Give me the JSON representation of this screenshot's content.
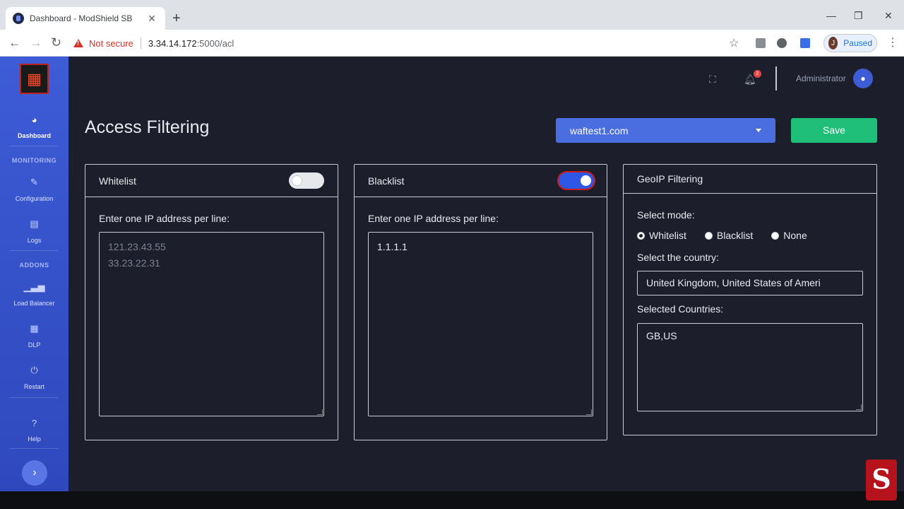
{
  "browser": {
    "tab_title": "Dashboard - ModShield SB",
    "tab_close": "✕",
    "new_tab": "+",
    "not_secure": "Not secure",
    "url_host": "3.34.14.172",
    "url_path": ":5000/acl",
    "profile_initial": "J",
    "profile_status": "Paused",
    "window_controls": {
      "minimize": "—",
      "maximize": "❐",
      "close": "✕"
    }
  },
  "sidebar": {
    "items": [
      {
        "label": "Dashboard",
        "icon": "dashboard-icon",
        "active": true
      },
      {
        "label": "Configuration",
        "icon": "wrench-icon"
      },
      {
        "label": "Logs",
        "icon": "logs-icon"
      },
      {
        "label": "Load Balancer",
        "icon": "chart-icon"
      },
      {
        "label": "DLP",
        "icon": "grid-icon"
      },
      {
        "label": "Restart",
        "icon": "power-icon"
      },
      {
        "label": "Help",
        "icon": "help-icon"
      }
    ],
    "sections": {
      "monitoring": "MONITORING",
      "addons": "ADDONS"
    }
  },
  "topbar": {
    "notification_count": "2",
    "user_name": "Administrator"
  },
  "page": {
    "title": "Access Filtering",
    "site_selected": "waftest1.com",
    "save_label": "Save"
  },
  "whitelist": {
    "title": "Whitelist",
    "enabled": false,
    "instruction": "Enter one IP address per line:",
    "placeholder_lines": [
      "121.23.43.55",
      "33.23.22.31"
    ]
  },
  "blacklist": {
    "title": "Blacklist",
    "enabled": true,
    "instruction": "Enter one IP address per line:",
    "value_lines": [
      "1.1.1.1"
    ]
  },
  "geoip": {
    "title": "GeoIP Filtering",
    "mode_label": "Select mode:",
    "modes": [
      {
        "label": "Whitelist",
        "checked": true
      },
      {
        "label": "Blacklist",
        "checked": false
      },
      {
        "label": "None",
        "checked": false
      }
    ],
    "country_label": "Select the country:",
    "country_value": "United Kingdom, United States of Ameri",
    "selected_label": "Selected Countries:",
    "selected_value": "GB,US"
  },
  "colors": {
    "sidebar": "#3d5cd6",
    "background": "#1c1f2b",
    "save": "#1fbf7a",
    "select": "#4a6ee0",
    "toggle_on": "#2f57e6"
  }
}
